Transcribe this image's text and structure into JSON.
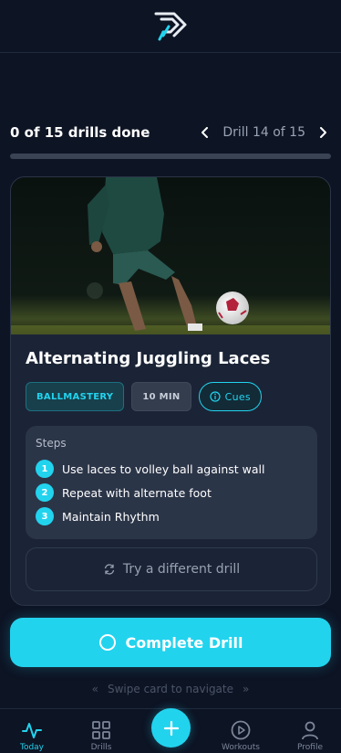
{
  "colors": {
    "accent": "#22d3ee",
    "background": "#0d1424",
    "card": "#1b2436"
  },
  "header": {
    "logo": "arrow-logo-icon"
  },
  "progress": {
    "label": "0 of 15 drills done",
    "done": 0,
    "total": 15,
    "fraction": 0.0,
    "drill_position": "Drill 14 of 15"
  },
  "drill": {
    "title": "Alternating Juggling Laces",
    "category": "BALLMASTERY",
    "duration": "10 MIN",
    "cues_label": "Cues",
    "steps_heading": "Steps",
    "steps": [
      {
        "num": "1",
        "text": "Use laces to volley ball against wall"
      },
      {
        "num": "2",
        "text": "Repeat with alternate foot"
      },
      {
        "num": "3",
        "text": "Maintain Rhythm"
      }
    ],
    "try_different_label": "Try a different drill"
  },
  "complete_button": {
    "label": "Complete Drill"
  },
  "swipe_hint": "Swipe card to navigate",
  "bottom_nav": {
    "items": [
      {
        "label": "Today",
        "icon": "activity-icon",
        "active": true
      },
      {
        "label": "Drills",
        "icon": "grid-icon",
        "active": false
      },
      {
        "label": "Workouts",
        "icon": "play-circle-icon",
        "active": false
      },
      {
        "label": "Profile",
        "icon": "user-icon",
        "active": false
      }
    ],
    "fab_icon": "plus-icon"
  }
}
